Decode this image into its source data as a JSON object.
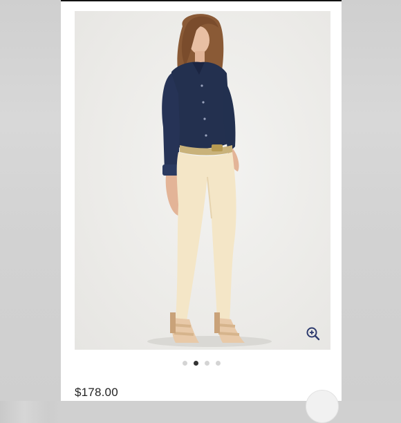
{
  "listing": {
    "price": "$178.00",
    "gallery": {
      "image_count": 4,
      "active_index": 1
    },
    "zoom_icon": "zoom-in-icon"
  },
  "colors": {
    "accent": "#2d3a6e",
    "dot_active": "#333333",
    "dot_inactive": "#d4d4d4"
  }
}
